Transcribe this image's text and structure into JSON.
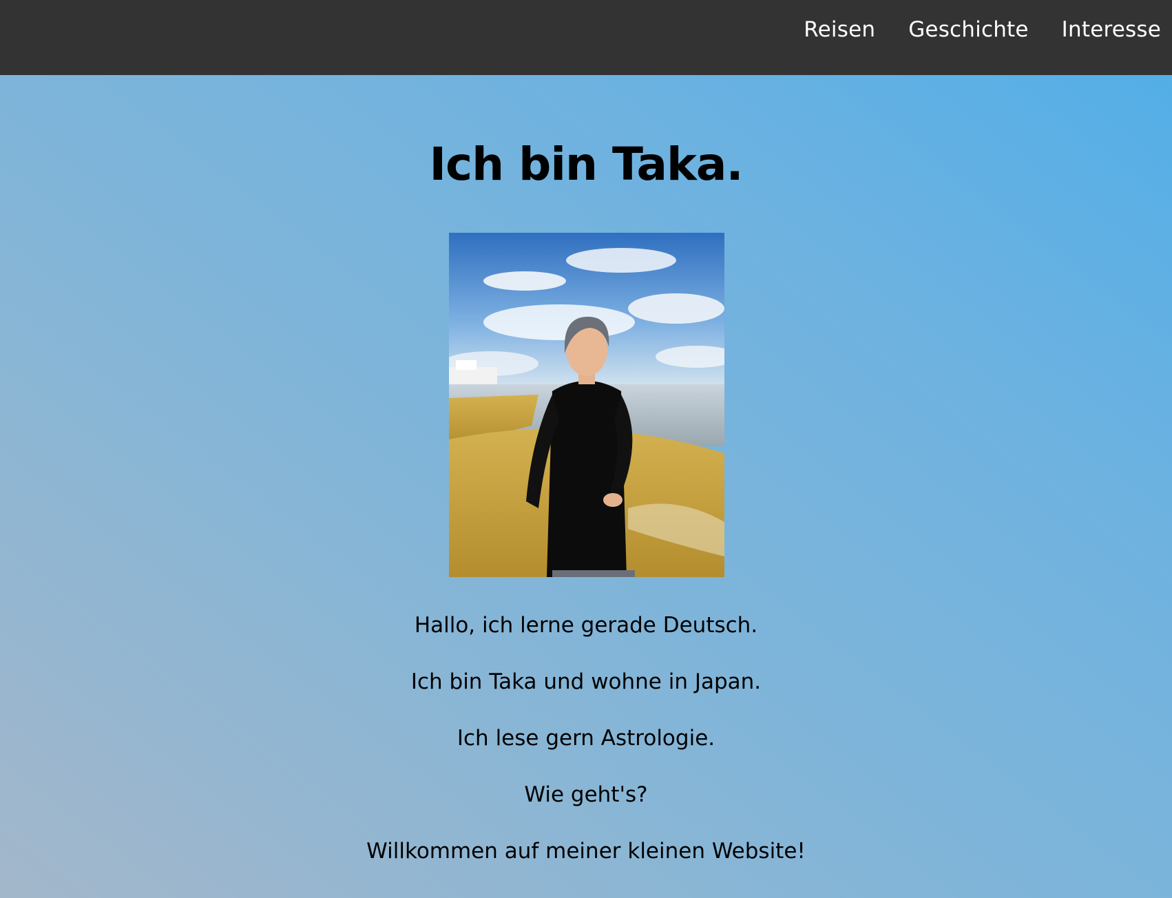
{
  "nav": {
    "items": [
      "Reisen",
      "Geschichte",
      "Interesse"
    ]
  },
  "hero": {
    "title": "Ich bin Taka.",
    "photo_icon": "portrait-photo"
  },
  "intro": {
    "paragraphs": [
      "Hallo, ich lerne gerade Deutsch.",
      "Ich bin Taka und wohne in Japan.",
      "Ich lese gern Astrologie.",
      "Wie geht's?",
      "Willkommen auf meiner kleinen Website!"
    ]
  },
  "colors": {
    "topbar": "#333333",
    "gradient_start": "#a3b7ca",
    "gradient_end": "#4faee8"
  }
}
